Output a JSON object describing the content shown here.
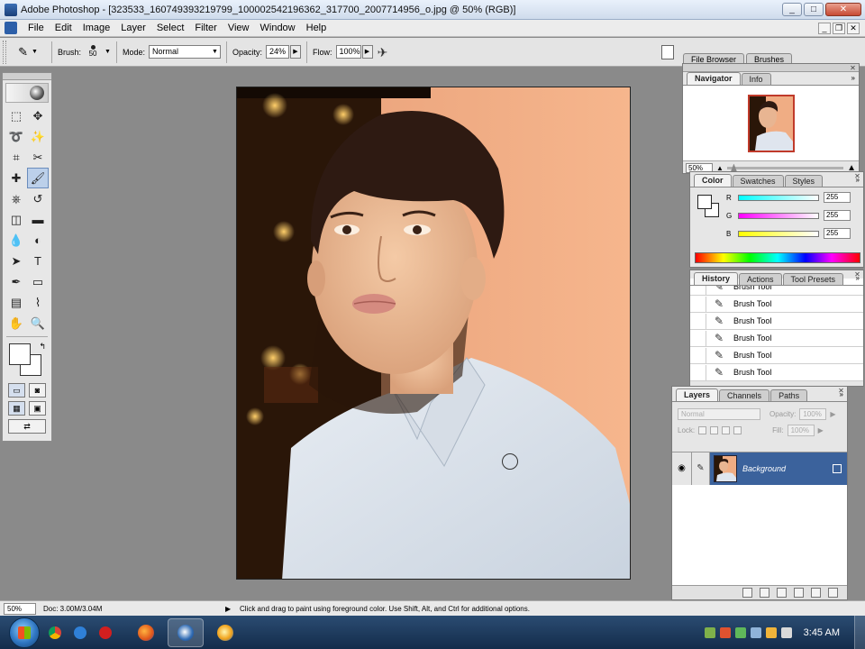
{
  "window": {
    "title": "Adobe Photoshop - [323533_160749393219799_100002542196362_317700_2007714956_o.jpg @ 50% (RGB)]",
    "minimize": "_",
    "maximize": "□",
    "close": "✕"
  },
  "menu": {
    "items": [
      "File",
      "Edit",
      "Image",
      "Layer",
      "Select",
      "Filter",
      "View",
      "Window",
      "Help"
    ],
    "doc_min": "_",
    "doc_restore": "❐",
    "doc_close": "✕"
  },
  "options": {
    "brush_label": "Brush:",
    "brush_size": "50",
    "mode_label": "Mode:",
    "mode_value": "Normal",
    "opacity_label": "Opacity:",
    "opacity_value": "24%",
    "flow_label": "Flow:",
    "flow_value": "100%",
    "well_tabs": [
      "File Browser",
      "Brushes"
    ]
  },
  "toolbox": {
    "tools": [
      "marquee-icon",
      "move-icon",
      "lasso-icon",
      "magic-wand-icon",
      "crop-icon",
      "slice-icon",
      "healing-brush-icon",
      "brush-icon",
      "clone-stamp-icon",
      "history-brush-icon",
      "eraser-icon",
      "gradient-icon",
      "blur-icon",
      "dodge-icon",
      "path-selection-icon",
      "type-icon",
      "pen-icon",
      "rectangle-icon",
      "notes-icon",
      "eyedropper-icon",
      "hand-icon",
      "zoom-icon"
    ],
    "glyphs": [
      "⬚",
      "✥",
      "➰",
      "✨",
      "⌗",
      "✂",
      "✚",
      "🖌",
      "⎈",
      "↺",
      "◫",
      "▬",
      "💧",
      "◐",
      "➤",
      "T",
      "✒",
      "▭",
      "▤",
      "⌇",
      "✋",
      "🔍"
    ],
    "active_tool": "brush-icon",
    "foreground_color": "#ffffff",
    "background_color": "#ffffff"
  },
  "status": {
    "zoom": "50%",
    "doc_info": "Doc: 3.00M/3.04M",
    "message": "Click and drag to paint using foreground color.  Use Shift, Alt, and Ctrl for additional options."
  },
  "navigator": {
    "tabs": [
      "Navigator",
      "Info"
    ],
    "zoom": "50%",
    "more": "»"
  },
  "color_panel": {
    "tabs": [
      "Color",
      "Swatches",
      "Styles"
    ],
    "channels": [
      {
        "name": "R",
        "value": "255",
        "gradient": "#00ffff"
      },
      {
        "name": "G",
        "value": "255",
        "gradient": "#ff00ff"
      },
      {
        "name": "B",
        "value": "255",
        "gradient": "#ffff00"
      }
    ],
    "more": "»"
  },
  "history": {
    "tabs": [
      "History",
      "Actions",
      "Tool Presets"
    ],
    "items": [
      "Brush Tool",
      "Brush Tool",
      "Brush Tool",
      "Brush Tool",
      "Brush Tool",
      "Brush Tool"
    ],
    "more": "»"
  },
  "layers": {
    "tabs": [
      "Layers",
      "Channels",
      "Paths"
    ],
    "blend_mode": "Normal",
    "opacity_label": "Opacity:",
    "opacity_value": "100%",
    "lock_label": "Lock:",
    "fill_label": "Fill:",
    "fill_value": "100%",
    "layer_name": "Background",
    "more": "»"
  },
  "taskbar": {
    "clock": "3:45 AM",
    "apps": [
      "firefox-icon",
      "photoshop-icon",
      "browser-icon"
    ]
  }
}
